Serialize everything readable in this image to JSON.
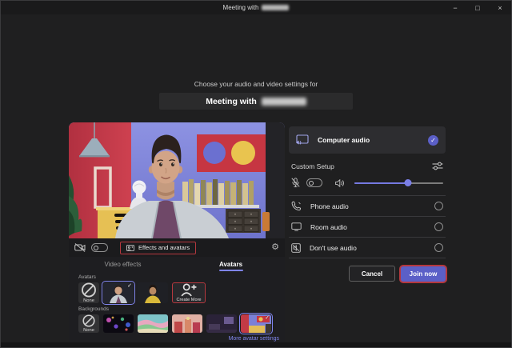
{
  "window": {
    "title_prefix": "Meeting with",
    "controls": {
      "minimize": "−",
      "maximize": "□",
      "close": "×"
    }
  },
  "header": {
    "subtitle": "Choose your audio and video settings for",
    "meeting_prefix": "Meeting with"
  },
  "video_panel": {
    "camera_on": false,
    "effects_button": "Effects and avatars",
    "tabs": [
      {
        "label": "Video effects",
        "active": false
      },
      {
        "label": "Avatars",
        "active": true
      }
    ],
    "avatars": {
      "heading": "Avatars",
      "none_label": "None",
      "create_label": "Create More",
      "selected_index": 1,
      "check": "✓"
    },
    "backgrounds": {
      "heading": "Backgrounds",
      "none_label": "None",
      "selected_index": 5,
      "check": "✓"
    },
    "more_link": "More avatar settings"
  },
  "audio_panel": {
    "computer_audio": {
      "label": "Computer audio",
      "selected": true,
      "check": "✓"
    },
    "custom_setup_label": "Custom Setup",
    "mic_muted": true,
    "volume_fill": "60%",
    "options": [
      {
        "label": "Phone audio",
        "selected": false
      },
      {
        "label": "Room audio",
        "selected": false
      },
      {
        "label": "Don't use audio",
        "selected": false
      }
    ]
  },
  "footer": {
    "cancel_label": "Cancel",
    "join_label": "Join now"
  },
  "icons": {
    "gear": "⚙"
  },
  "colors": {
    "accent": "#5b5fc7",
    "link": "#8288f0",
    "annotation_red": "#b5383e",
    "selection_border": "#7f84eb"
  }
}
